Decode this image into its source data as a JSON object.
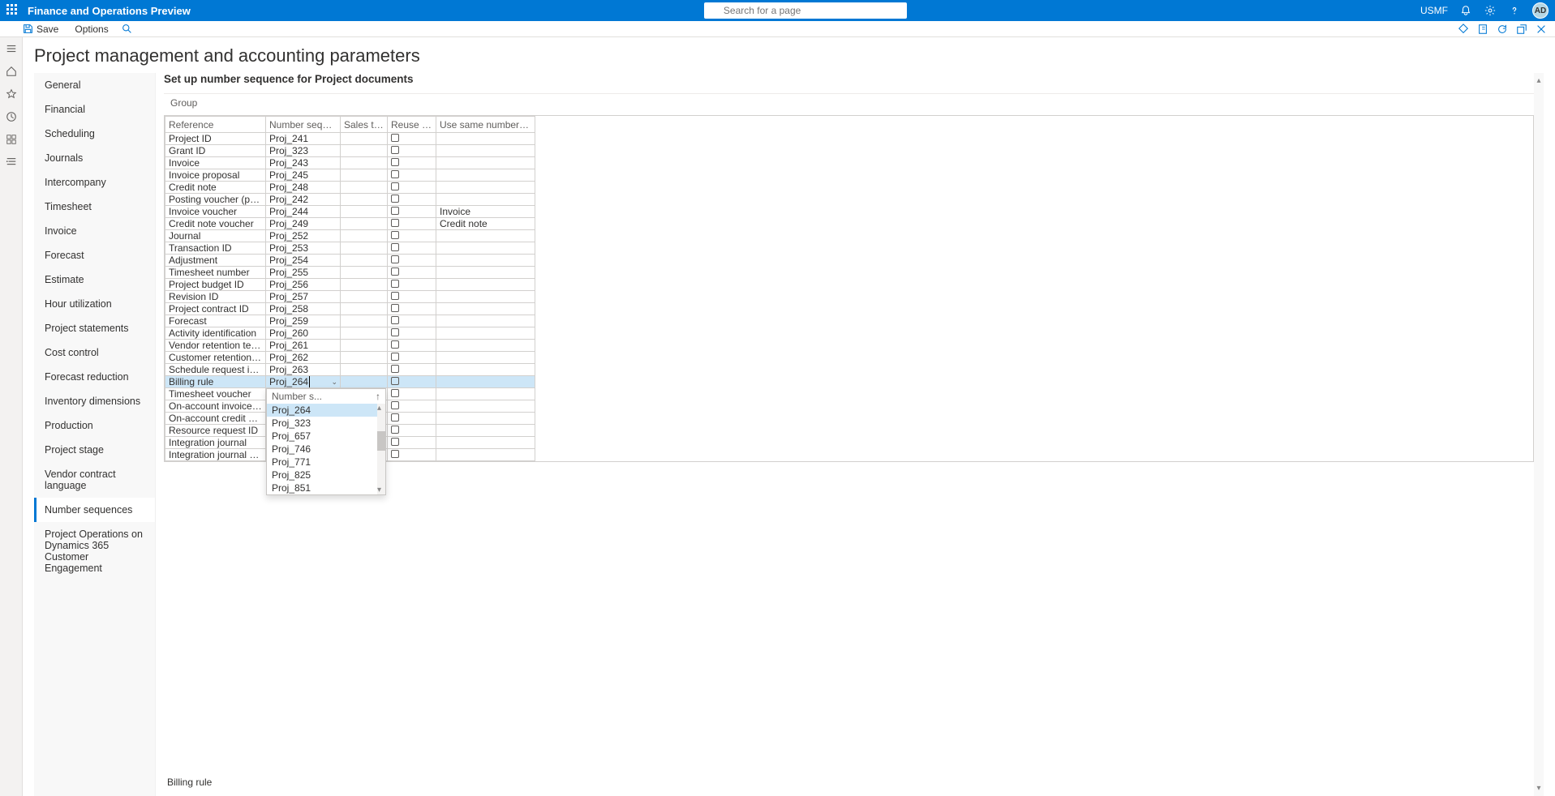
{
  "header": {
    "app_title": "Finance and Operations Preview",
    "search_placeholder": "Search for a page",
    "company": "USMF",
    "avatar": "AD"
  },
  "actionbar": {
    "save": "Save",
    "options": "Options"
  },
  "page": {
    "title": "Project management and accounting parameters",
    "section_title": "Set up number sequence for Project documents",
    "fasttab_group": "Group",
    "footer": "Billing rule"
  },
  "sidebar": {
    "items": [
      "General",
      "Financial",
      "Scheduling",
      "Journals",
      "Intercompany",
      "Timesheet",
      "Invoice",
      "Forecast",
      "Estimate",
      "Hour utilization",
      "Project statements",
      "Cost control",
      "Forecast reduction",
      "Inventory dimensions",
      "Production",
      "Project stage",
      "Vendor contract language",
      "Number sequences",
      "Project Operations on Dynamics 365 Customer Engagement"
    ],
    "active_index": 17
  },
  "grid": {
    "headers": {
      "reference": "Reference",
      "code": "Number sequence code",
      "sales": "Sales tax boo...",
      "reuse": "Reuse numb...",
      "same": "Use same number as"
    },
    "selected_index": 20,
    "rows": [
      {
        "ref": "Project ID",
        "code": "Proj_241",
        "same": ""
      },
      {
        "ref": "Grant ID",
        "code": "Proj_323",
        "same": ""
      },
      {
        "ref": "Invoice",
        "code": "Proj_243",
        "same": ""
      },
      {
        "ref": "Invoice proposal",
        "code": "Proj_245",
        "same": ""
      },
      {
        "ref": "Credit note",
        "code": "Proj_248",
        "same": ""
      },
      {
        "ref": "Posting voucher (periodic)",
        "code": "Proj_242",
        "same": ""
      },
      {
        "ref": "Invoice voucher",
        "code": "Proj_244",
        "same": "Invoice"
      },
      {
        "ref": "Credit note voucher",
        "code": "Proj_249",
        "same": "Credit note"
      },
      {
        "ref": "Journal",
        "code": "Proj_252",
        "same": ""
      },
      {
        "ref": "Transaction ID",
        "code": "Proj_253",
        "same": ""
      },
      {
        "ref": "Adjustment",
        "code": "Proj_254",
        "same": ""
      },
      {
        "ref": "Timesheet number",
        "code": "Proj_255",
        "same": ""
      },
      {
        "ref": "Project budget ID",
        "code": "Proj_256",
        "same": ""
      },
      {
        "ref": "Revision ID",
        "code": "Proj_257",
        "same": ""
      },
      {
        "ref": "Project contract ID",
        "code": "Proj_258",
        "same": ""
      },
      {
        "ref": "Forecast",
        "code": "Proj_259",
        "same": ""
      },
      {
        "ref": "Activity identification",
        "code": "Proj_260",
        "same": ""
      },
      {
        "ref": "Vendor retention term",
        "code": "Proj_261",
        "same": ""
      },
      {
        "ref": "Customer retention terms",
        "code": "Proj_262",
        "same": ""
      },
      {
        "ref": "Schedule request identification",
        "code": "Proj_263",
        "same": ""
      },
      {
        "ref": "Billing rule",
        "code": "Proj_264",
        "same": ""
      },
      {
        "ref": "Timesheet voucher",
        "code": "",
        "same": ""
      },
      {
        "ref": "On-account invoice voucher",
        "code": "",
        "same": ""
      },
      {
        "ref": "On-account credit note vouc...",
        "code": "",
        "same": ""
      },
      {
        "ref": "Resource request ID",
        "code": "",
        "same": ""
      },
      {
        "ref": "Integration journal",
        "code": "",
        "same": ""
      },
      {
        "ref": "Integration journal entries",
        "code": "",
        "same": ""
      }
    ]
  },
  "dropdown": {
    "header": "Number s...",
    "items": [
      "Proj_264",
      "Proj_323",
      "Proj_657",
      "Proj_746",
      "Proj_771",
      "Proj_825",
      "Proj_851"
    ],
    "selected_index": 0
  }
}
